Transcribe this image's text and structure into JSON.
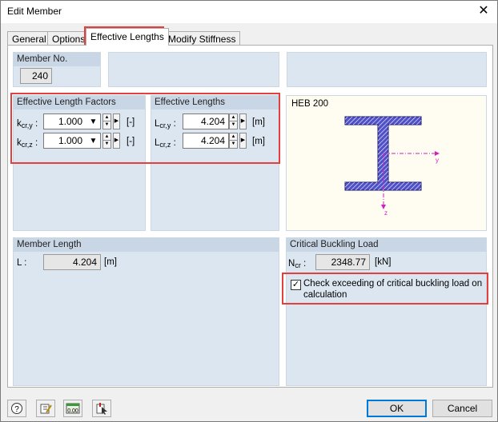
{
  "window": {
    "title": "Edit Member"
  },
  "tabs": [
    {
      "label": "General"
    },
    {
      "label": "Options"
    },
    {
      "label": "Effective Lengths"
    },
    {
      "label": "Modify Stiffness"
    }
  ],
  "member_no": {
    "header": "Member No.",
    "value": "240"
  },
  "factors": {
    "header": "Effective Length Factors",
    "kcry_label": "k",
    "kcry_sub": "cr,y",
    "kcry_value": "1.000",
    "kcry_unit": "[-]",
    "kcrz_label": "k",
    "kcrz_sub": "cr,z",
    "kcrz_value": "1.000",
    "kcrz_unit": "[-]"
  },
  "lengths": {
    "header": "Effective Lengths",
    "lcry_label": "L",
    "lcry_sub": "cr,y",
    "lcry_value": "4.204",
    "lcry_unit": "[m]",
    "lcrz_label": "L",
    "lcrz_sub": "cr,z",
    "lcrz_value": "4.204",
    "lcrz_unit": "[m]"
  },
  "section": {
    "name": "HEB 200",
    "axis_y": "y",
    "axis_z": "z"
  },
  "member_length": {
    "header": "Member Length",
    "label": "L :",
    "value": "4.204",
    "unit": "[m]"
  },
  "critical": {
    "header": "Critical Buckling Load",
    "ncr_label": "N",
    "ncr_sub": "cr",
    "ncr_colon": " :",
    "ncr_value": "2348.77",
    "ncr_unit": "[kN]",
    "check_label_line1": "Check exceeding of critical buckling load on",
    "check_label_line2": "calculation",
    "checked": true
  },
  "footer": {
    "ok": "OK",
    "cancel": "Cancel"
  },
  "colors": {
    "highlight": "#e0413f",
    "group_bg": "#dce6f1",
    "section_fill": "#4040c0"
  }
}
